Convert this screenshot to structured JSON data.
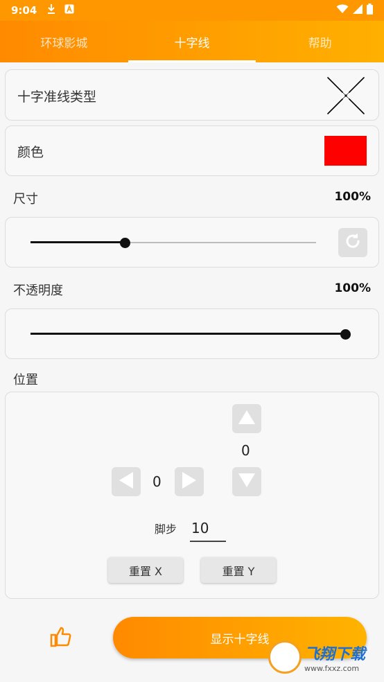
{
  "status_bar": {
    "time": "9:04",
    "icons": [
      "download-icon",
      "font-icon",
      "wifi-icon",
      "signal-icon",
      "battery-icon"
    ]
  },
  "tabs": [
    {
      "label": "环球影城",
      "active": false
    },
    {
      "label": "十字线",
      "active": true
    },
    {
      "label": "帮助",
      "active": false
    }
  ],
  "crosshair_type": {
    "label": "十字准线类型",
    "icon": "x-crosshair-icon"
  },
  "color": {
    "label": "颜色",
    "value": "#ff0000"
  },
  "size": {
    "label": "尺寸",
    "value_text": "100%",
    "slider_fraction": 0.33
  },
  "opacity": {
    "label": "不透明度",
    "value_text": "100%",
    "slider_fraction": 1.0
  },
  "position": {
    "label": "位置",
    "x_value": "0",
    "y_value": "0",
    "step_label": "脚步",
    "step_value": "10",
    "reset_x_label": "重置 X",
    "reset_y_label": "重置 Y"
  },
  "show_button": {
    "label": "显示十字线"
  },
  "watermark": {
    "title": "飞翔下载",
    "url": "www.fxxz.com"
  },
  "colors": {
    "accent": "#ff9800",
    "accent_end": "#ffb300",
    "swatch": "#ff0000"
  }
}
